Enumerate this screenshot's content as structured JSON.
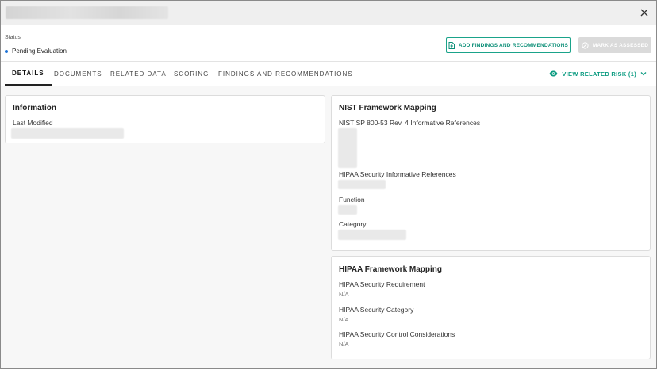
{
  "header": {
    "status_label": "Status",
    "status_value": "Pending Evaluation",
    "add_findings_label": "ADD FINDINGS AND RECOMMENDATIONS",
    "mark_assessed_label": "MARK AS ASSESSED"
  },
  "tabs": [
    {
      "label": "DETAILS",
      "active": true
    },
    {
      "label": "DOCUMENTS",
      "active": false
    },
    {
      "label": "RELATED DATA",
      "active": false
    },
    {
      "label": "SCORING",
      "active": false
    },
    {
      "label": "FINDINGS AND RECOMMENDATIONS",
      "active": false
    }
  ],
  "related_risk_label": "VIEW RELATED RISK (1)",
  "information": {
    "title": "Information",
    "last_modified_label": "Last Modified"
  },
  "nist": {
    "title": "NIST Framework Mapping",
    "references_label": "NIST SP 800-53 Rev. 4 Informative References",
    "hipaa_references_label": "HIPAA Security Informative References",
    "function_label": "Function",
    "category_label": "Category"
  },
  "hipaa": {
    "title": "HIPAA Framework Mapping",
    "requirement_label": "HIPAA Security Requirement",
    "requirement_value": "N/A",
    "category_label": "HIPAA Security Category",
    "category_value": "N/A",
    "control_label": "HIPAA Security Control Considerations",
    "control_value": "N/A"
  },
  "colors": {
    "accent": "#0d9c82",
    "status_dot": "#1e73d6",
    "disabled_button": "#dadada"
  },
  "icons": {
    "close": "close-icon",
    "document": "document-icon",
    "disabled": "ban-icon",
    "eye": "eye-icon",
    "chevron": "chevron-down-icon"
  }
}
